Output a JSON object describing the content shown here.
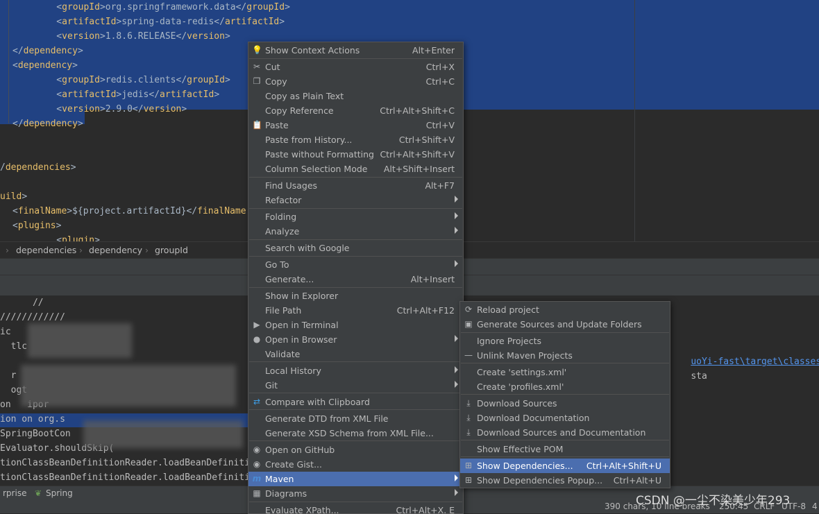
{
  "editor": {
    "lines": [
      {
        "pre": "    <",
        "tag": "groupId",
        "mid": ">org.springframework.data</",
        "tag2": "groupId",
        "post": ">"
      },
      {
        "pre": "    <",
        "tag": "artifactId",
        "mid": ">spring-data-redis</",
        "tag2": "artifactId",
        "post": ">"
      },
      {
        "pre": "    <",
        "tag": "version",
        "mid": ">1.8.6.RELEASE</",
        "tag2": "version",
        "post": ">"
      },
      {
        "pre": "</",
        "tag": "dependency",
        "mid": ">",
        "tag2": "",
        "post": ""
      },
      {
        "pre": "<",
        "tag": "dependency",
        "mid": ">",
        "tag2": "",
        "post": ""
      },
      {
        "pre": "    <",
        "tag": "groupId",
        "mid": ">redis.clients</",
        "tag2": "groupId",
        "post": ">"
      },
      {
        "pre": "    <",
        "tag": "artifactId",
        "mid": ">jedis</",
        "tag2": "artifactId",
        "post": ">"
      },
      {
        "pre": "    <",
        "tag": "version",
        "mid": ">2.9.0</",
        "tag2": "version",
        "post": ">"
      },
      {
        "pre": "</",
        "tag": "dependency",
        "mid": ">",
        "tag2": "",
        "post": ""
      },
      {
        "pre": "",
        "tag": "",
        "mid": "",
        "tag2": "",
        "post": ""
      },
      {
        "pre": "",
        "tag": "",
        "mid": "",
        "tag2": "",
        "post": ""
      },
      {
        "pre": "/",
        "tag": "dependencies",
        "mid": ">",
        "tag2": "",
        "post": ""
      },
      {
        "pre": "",
        "tag": "",
        "mid": "",
        "tag2": "",
        "post": ""
      },
      {
        "pre": "",
        "tag": "uild",
        "mid": ">",
        "tag2": "",
        "post": ""
      },
      {
        "pre": "<",
        "tag": "finalName",
        "mid": ">${project.artifactId}</",
        "tag2": "finalName",
        "post": ""
      },
      {
        "pre": "<",
        "tag": "plugins",
        "mid": ">",
        "tag2": "",
        "post": ""
      },
      {
        "pre": "    <",
        "tag": "plugin",
        "mid": ">",
        "tag2": "",
        "post": ""
      }
    ]
  },
  "breadcrumb": [
    "dependencies",
    "dependency",
    "groupId"
  ],
  "console": {
    "lines": [
      "      //",
      "////////////",
      "ic",
      "  tlc",
      "",
      "  r",
      "  ogt",
      "on   ipor",
      "ion on org.s",
      "SpringBootCon",
      "Evaluator.shouldSkip(",
      "tionClassBeanDefinitionReader.loadBeanDefiniti",
      "tionClassBeanDefinitionReader.loadBeanDefiniti"
    ],
    "right_link": "uoYi-fast\\target\\classes",
    "right_tail": "sta"
  },
  "statusbar": {
    "left1": "rprise",
    "left2": "Spring",
    "chars": "390 chars, 10 line breaks",
    "pos": "250:45",
    "eol": "CRLF",
    "enc": "UTF-8",
    "extra": "4"
  },
  "watermark": "CSDN @一尘不染美少年293",
  "context_menu": {
    "items": [
      {
        "label": "Show Context Actions",
        "shortcut": "Alt+Enter",
        "icon": "lightbulb-icon",
        "glyph": "💡"
      },
      {
        "label": "Cut",
        "shortcut": "Ctrl+X",
        "icon": "scissors-icon",
        "glyph": "✂"
      },
      {
        "label": "Copy",
        "shortcut": "Ctrl+C",
        "icon": "copy-icon",
        "glyph": "❐"
      },
      {
        "label": "Copy as Plain Text",
        "shortcut": "",
        "icon": "",
        "glyph": ""
      },
      {
        "label": "Copy Reference",
        "shortcut": "Ctrl+Alt+Shift+C",
        "icon": "",
        "glyph": ""
      },
      {
        "label": "Paste",
        "shortcut": "Ctrl+V",
        "icon": "clipboard-icon",
        "glyph": "📋"
      },
      {
        "label": "Paste from History...",
        "shortcut": "Ctrl+Shift+V",
        "icon": "",
        "glyph": ""
      },
      {
        "label": "Paste without Formatting",
        "shortcut": "Ctrl+Alt+Shift+V",
        "icon": "",
        "glyph": ""
      },
      {
        "label": "Column Selection Mode",
        "shortcut": "Alt+Shift+Insert",
        "icon": "",
        "glyph": ""
      },
      {
        "label": "Find Usages",
        "shortcut": "Alt+F7",
        "icon": "",
        "glyph": ""
      },
      {
        "label": "Refactor",
        "shortcut": "",
        "icon": "",
        "glyph": "",
        "submenu": true
      },
      {
        "label": "Folding",
        "shortcut": "",
        "icon": "",
        "glyph": "",
        "submenu": true
      },
      {
        "label": "Analyze",
        "shortcut": "",
        "icon": "",
        "glyph": "",
        "submenu": true
      },
      {
        "label": "Search with Google",
        "shortcut": "",
        "icon": "",
        "glyph": ""
      },
      {
        "label": "Go To",
        "shortcut": "",
        "icon": "",
        "glyph": "",
        "submenu": true
      },
      {
        "label": "Generate...",
        "shortcut": "Alt+Insert",
        "icon": "",
        "glyph": ""
      },
      {
        "label": "Show in Explorer",
        "shortcut": "",
        "icon": "",
        "glyph": ""
      },
      {
        "label": "File Path",
        "shortcut": "Ctrl+Alt+F12",
        "icon": "",
        "glyph": ""
      },
      {
        "label": "Open in Terminal",
        "shortcut": "",
        "icon": "terminal-icon",
        "glyph": "▶"
      },
      {
        "label": "Open in Browser",
        "shortcut": "",
        "icon": "globe-icon",
        "glyph": "●",
        "submenu": true
      },
      {
        "label": "Validate",
        "shortcut": "",
        "icon": "",
        "glyph": ""
      },
      {
        "label": "Local History",
        "shortcut": "",
        "icon": "",
        "glyph": "",
        "submenu": true
      },
      {
        "label": "Git",
        "shortcut": "",
        "icon": "",
        "glyph": "",
        "submenu": true
      },
      {
        "label": "Compare with Clipboard",
        "shortcut": "",
        "icon": "compare-icon",
        "glyph": "⇄"
      },
      {
        "label": "Generate DTD from XML File",
        "shortcut": "",
        "icon": "",
        "glyph": ""
      },
      {
        "label": "Generate XSD Schema from XML File...",
        "shortcut": "",
        "icon": "",
        "glyph": ""
      },
      {
        "label": "Open on GitHub",
        "shortcut": "",
        "icon": "github-icon",
        "glyph": "◉"
      },
      {
        "label": "Create Gist...",
        "shortcut": "",
        "icon": "github-icon",
        "glyph": "◉"
      },
      {
        "label": "Maven",
        "shortcut": "",
        "icon": "maven-icon",
        "glyph": "m",
        "submenu": true
      },
      {
        "label": "Diagrams",
        "shortcut": "",
        "icon": "diagram-icon",
        "glyph": "▦",
        "submenu": true
      },
      {
        "label": "Evaluate XPath...",
        "shortcut": "Ctrl+Alt+X, E",
        "icon": "",
        "glyph": ""
      }
    ]
  },
  "maven_submenu": {
    "items": [
      {
        "label": "Reload project",
        "shortcut": "",
        "icon": "reload-icon",
        "glyph": "⟳"
      },
      {
        "label": "Generate Sources and Update Folders",
        "shortcut": "",
        "icon": "generate-sources-icon",
        "glyph": "▣"
      },
      {
        "label": "Ignore Projects",
        "shortcut": "",
        "icon": "",
        "glyph": ""
      },
      {
        "label": "Unlink Maven Projects",
        "shortcut": "",
        "icon": "minus-icon",
        "glyph": "—"
      },
      {
        "label": "Create 'settings.xml'",
        "shortcut": "",
        "icon": "",
        "glyph": ""
      },
      {
        "label": "Create 'profiles.xml'",
        "shortcut": "",
        "icon": "",
        "glyph": ""
      },
      {
        "label": "Download Sources",
        "shortcut": "",
        "icon": "download-icon",
        "glyph": "⤓"
      },
      {
        "label": "Download Documentation",
        "shortcut": "",
        "icon": "download-icon",
        "glyph": "⤓"
      },
      {
        "label": "Download Sources and Documentation",
        "shortcut": "",
        "icon": "download-icon",
        "glyph": "⤓"
      },
      {
        "label": "Show Effective POM",
        "shortcut": "",
        "icon": "",
        "glyph": ""
      },
      {
        "label": "Show Dependencies...",
        "shortcut": "Ctrl+Alt+Shift+U",
        "icon": "dependencies-icon",
        "glyph": "⊞"
      },
      {
        "label": "Show Dependencies Popup...",
        "shortcut": "Ctrl+Alt+U",
        "icon": "dependencies-icon",
        "glyph": "⊞"
      }
    ]
  }
}
